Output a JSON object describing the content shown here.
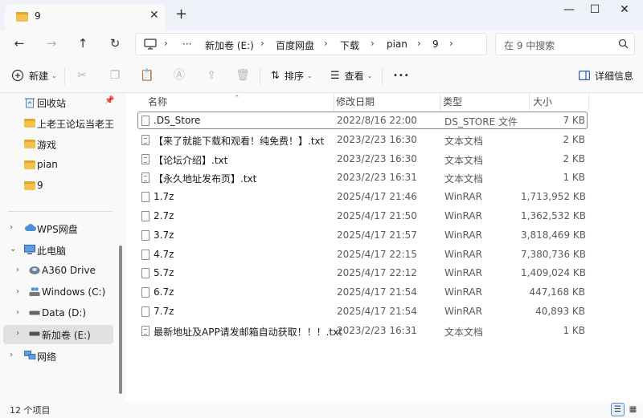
{
  "tab": {
    "title": "9"
  },
  "address": {
    "crumbs": [
      "新加卷 (E:)",
      "百度网盘",
      "下载",
      "pian",
      "9"
    ],
    "more": "···"
  },
  "search": {
    "placeholder": "在 9 中搜索"
  },
  "toolbar": {
    "new_label": "新建",
    "sort_label": "排序",
    "view_label": "查看",
    "more_label": "•••",
    "details_label": "详细信息"
  },
  "sidebar": {
    "quick": [
      {
        "label": "回收站",
        "icon": "recycle-bin-icon",
        "pinned": true
      },
      {
        "label": "上老王论坛当老王",
        "icon": "folder-icon"
      },
      {
        "label": "游戏",
        "icon": "folder-icon"
      },
      {
        "label": "pian",
        "icon": "folder-icon"
      },
      {
        "label": "9",
        "icon": "folder-icon"
      }
    ],
    "tree": [
      {
        "label": "WPS网盘",
        "icon": "cloud-icon"
      },
      {
        "label": "此电脑",
        "icon": "computer-icon",
        "expanded": true
      },
      {
        "label": "A360 Drive",
        "icon": "drive-icon"
      },
      {
        "label": "Windows (C:)",
        "icon": "drive-icon"
      },
      {
        "label": "Data (D:)",
        "icon": "drive-icon"
      },
      {
        "label": "新加卷 (E:)",
        "icon": "drive-icon",
        "selected": true
      },
      {
        "label": "网络",
        "icon": "network-icon"
      }
    ]
  },
  "table": {
    "columns": [
      "名称",
      "修改日期",
      "类型",
      "大小"
    ],
    "rows": [
      {
        "name": ".DS_Store",
        "date": "2022/8/16 22:00",
        "type": "DS_STORE 文件",
        "size": "7 KB",
        "kind": "file",
        "focused": true
      },
      {
        "name": "【来了就能下载和观看！纯免费！】.txt",
        "date": "2023/2/23 16:30",
        "type": "文本文档",
        "size": "2 KB",
        "kind": "txt"
      },
      {
        "name": "【论坛介绍】.txt",
        "date": "2023/2/23 16:30",
        "type": "文本文档",
        "size": "2 KB",
        "kind": "txt"
      },
      {
        "name": "【永久地址发布页】.txt",
        "date": "2023/2/23 16:31",
        "type": "文本文档",
        "size": "1 KB",
        "kind": "txt"
      },
      {
        "name": "1.7z",
        "date": "2025/4/17 21:46",
        "type": "WinRAR",
        "size": "1,713,952 KB",
        "kind": "file"
      },
      {
        "name": "2.7z",
        "date": "2025/4/17 21:50",
        "type": "WinRAR",
        "size": "1,362,532 KB",
        "kind": "file"
      },
      {
        "name": "3.7z",
        "date": "2025/4/17 21:57",
        "type": "WinRAR",
        "size": "3,818,469 KB",
        "kind": "file"
      },
      {
        "name": "4.7z",
        "date": "2025/4/17 22:15",
        "type": "WinRAR",
        "size": "7,380,736 KB",
        "kind": "file"
      },
      {
        "name": "5.7z",
        "date": "2025/4/17 22:12",
        "type": "WinRAR",
        "size": "1,409,024 KB",
        "kind": "file"
      },
      {
        "name": "6.7z",
        "date": "2025/4/17 21:54",
        "type": "WinRAR",
        "size": "447,168 KB",
        "kind": "file"
      },
      {
        "name": "7.7z",
        "date": "2025/4/17 21:54",
        "type": "WinRAR",
        "size": "40,893 KB",
        "kind": "file"
      },
      {
        "name": "最新地址及APP请发邮箱自动获取！！！.txt",
        "date": "2023/2/23 16:31",
        "type": "文本文档",
        "size": "1 KB",
        "kind": "txt"
      }
    ]
  },
  "status": {
    "count": "12 个项目"
  },
  "colors": {
    "folder": "#f2c14e",
    "accent": "#4a8fd8",
    "selected": "#e1e1e1"
  }
}
